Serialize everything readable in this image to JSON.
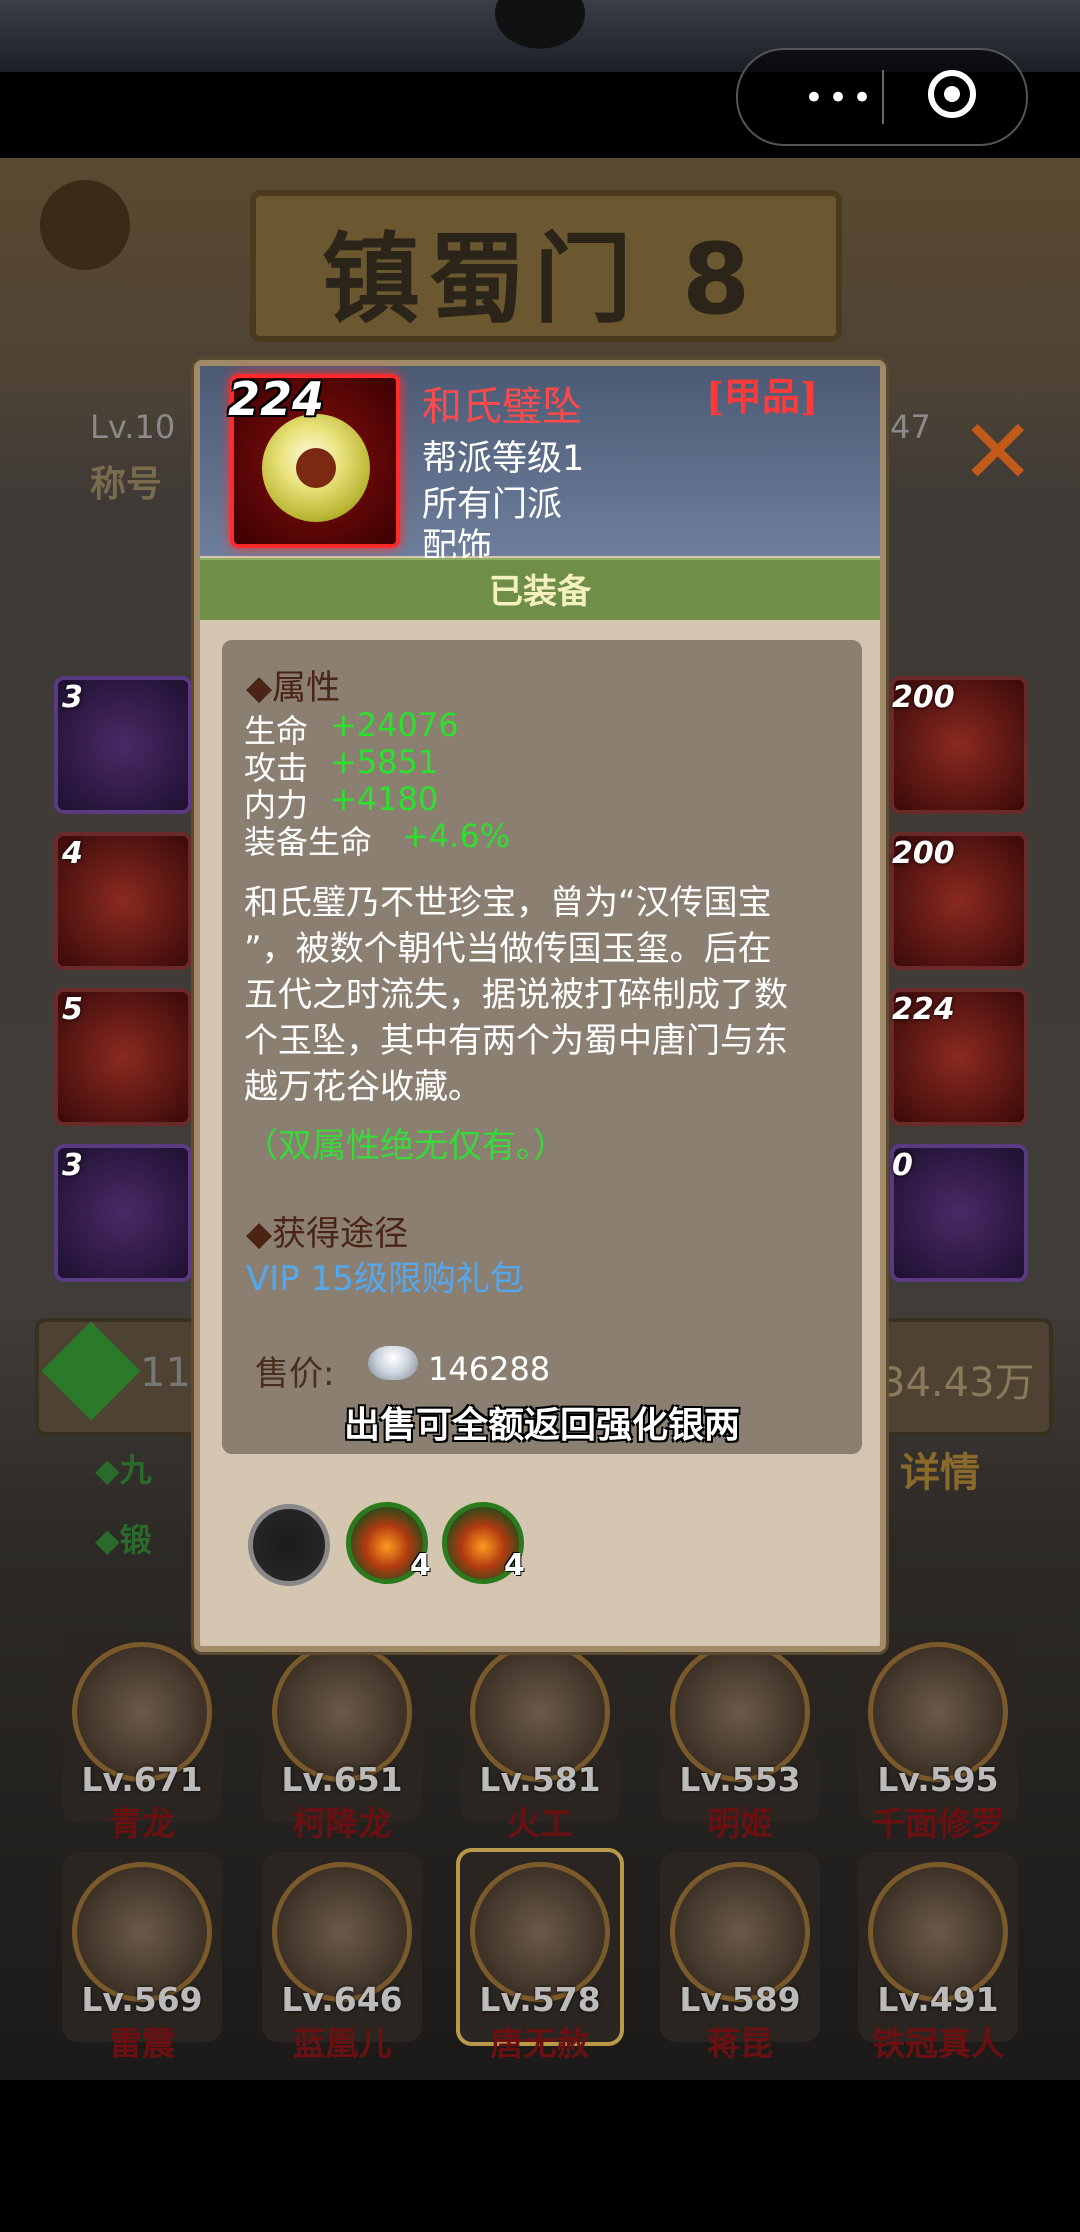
{
  "topbar": {
    "menu_dots": "•••"
  },
  "background": {
    "sect_name": "镇蜀门 8",
    "player_level": "Lv.10",
    "player_title": "称号",
    "power_suffix": "47",
    "fate_value_left": "11",
    "fate_value_right": "34.43万",
    "details_link": "详情",
    "nine_link": "◆九",
    "forge_link": "◆锻",
    "left_slots": [
      "3",
      "4",
      "5",
      "3"
    ],
    "right_slots": [
      "200",
      "200",
      "224",
      "0"
    ],
    "heroes_row1": [
      {
        "level": "Lv.671",
        "name": "青龙"
      },
      {
        "level": "Lv.651",
        "name": "柯降龙"
      },
      {
        "level": "Lv.581",
        "name": "火工"
      },
      {
        "level": "Lv.553",
        "name": "明姬"
      },
      {
        "level": "Lv.595",
        "name": "千面修罗"
      }
    ],
    "heroes_row2": [
      {
        "level": "Lv.569",
        "name": "雷震"
      },
      {
        "level": "Lv.646",
        "name": "蓝凰儿"
      },
      {
        "level": "Lv.578",
        "name": "唐无赦"
      },
      {
        "level": "Lv.589",
        "name": "蒋昆"
      },
      {
        "level": "Lv.491",
        "name": "铁冠真人"
      }
    ]
  },
  "item": {
    "enhance_level": "224",
    "name": "和氏璧坠",
    "grade": "[甲品]",
    "requirement_guild": "帮派等级1",
    "requirement_sect": "所有门派",
    "type": "配饰",
    "status": "已装备"
  },
  "attributes": {
    "title": "◆属性",
    "list": [
      {
        "name": "生命",
        "value": "+24076"
      },
      {
        "name": "攻击",
        "value": "+5851"
      },
      {
        "name": "内力",
        "value": "+4180"
      },
      {
        "name": "装备生命",
        "value": "+4.6%"
      }
    ]
  },
  "description": {
    "lines": [
      "和氏璧乃不世珍宝，曾为“汉传国宝",
      "”，被数个朝代当做传国玉玺。后在",
      "五代之时流失，据说被打碎制成了数",
      "个玉坠，其中有两个为蜀中唐门与东",
      "越万花谷收藏。"
    ],
    "note": "（双属性绝无仅有。）"
  },
  "source": {
    "title": "◆获得途径",
    "link": "VIP 15级限购礼包"
  },
  "price": {
    "label": "售价:",
    "value": "146288",
    "refund_note": "出售可全额返回强化银两"
  },
  "gems": [
    {
      "count": ""
    },
    {
      "count": "4"
    },
    {
      "count": "4"
    }
  ],
  "colors": {
    "grade_red": "#ff3a3a",
    "equipped_green": "#6f8f47",
    "attr_green": "#2ee02e",
    "link_blue": "#54a8ee",
    "note_green": "#3ad83a"
  }
}
